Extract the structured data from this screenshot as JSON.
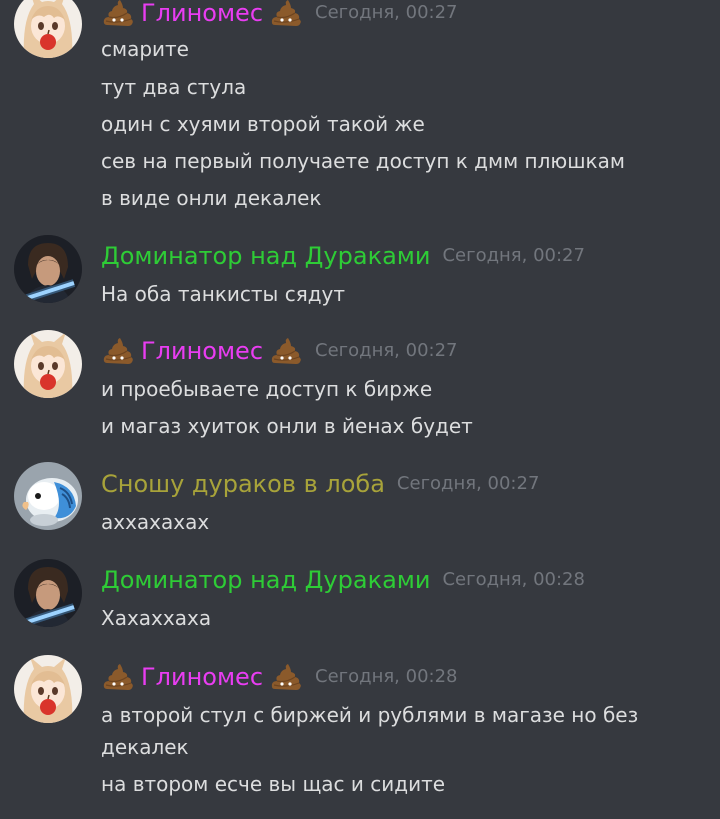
{
  "colors": {
    "background": "#36393f",
    "timestamp": "#72767d",
    "text": "#dcddde",
    "glinomes": "#e93df2",
    "dominator": "#2ecc36",
    "snoshu": "#a8a33a"
  },
  "messages": [
    {
      "author": "Глиномес",
      "avatar": "anime-girl-avatar",
      "name_emoji": "poop-emoji",
      "timestamp": "Сегодня, 00:27",
      "lines": [
        "смарите",
        "тут два стула",
        "один с хуями второй такой же",
        "сев на первый получаете доступ к дмм плюшкам",
        "в виде онли декалек"
      ]
    },
    {
      "author": "Доминатор над Дураками",
      "avatar": "dark-portrait-avatar",
      "timestamp": "Сегодня, 00:27",
      "lines": [
        "На оба танкисты сядут"
      ]
    },
    {
      "author": "Глиномес",
      "avatar": "anime-girl-avatar",
      "name_emoji": "poop-emoji",
      "timestamp": "Сегодня, 00:27",
      "lines": [
        "и проебываете доступ к бирже",
        "и магаз хуиток онли в йенах будет"
      ]
    },
    {
      "author": "Сношу дураков в лоба",
      "avatar": "parrot-avatar",
      "timestamp": "Сегодня, 00:27",
      "lines": [
        "аххахахах"
      ]
    },
    {
      "author": "Доминатор над Дураками",
      "avatar": "dark-portrait-avatar",
      "timestamp": "Сегодня, 00:28",
      "lines": [
        "Хахаххаха"
      ]
    },
    {
      "author": "Глиномес",
      "avatar": "anime-girl-avatar",
      "name_emoji": "poop-emoji",
      "timestamp": "Сегодня, 00:28",
      "lines": [
        "а второй стул с биржей и рублями в магазе но без",
        "декалек",
        "на втором есче вы щас и сидите"
      ]
    }
  ]
}
